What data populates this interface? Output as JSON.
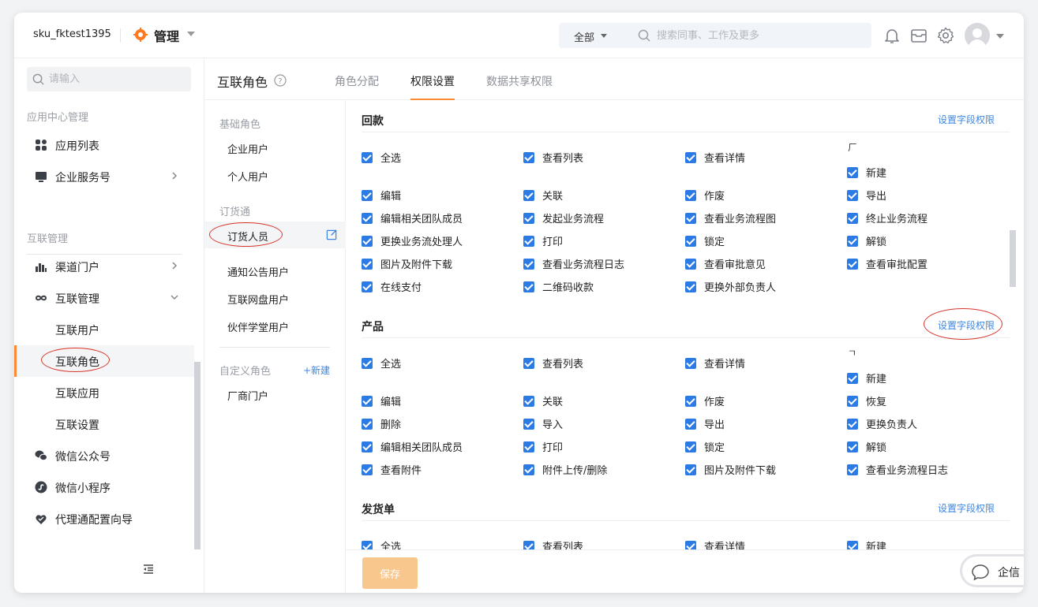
{
  "topbar": {
    "account": "sku_fktest1395",
    "brand": "管理",
    "scope": "全部",
    "search_placeholder": "搜索同事、工作及更多",
    "icons": [
      "bell-icon",
      "inbox-icon",
      "gear-icon",
      "avatar"
    ]
  },
  "sidebar": {
    "search_placeholder": "请输入",
    "section1": "应用中心管理",
    "app_list": "应用列表",
    "enterprise_service": "企业服务号",
    "section2": "互联管理",
    "channel_portal": "渠道门户",
    "interconnect_mgmt": "互联管理",
    "sub_users": "互联用户",
    "sub_roles": "互联角色",
    "sub_apps": "互联应用",
    "sub_settings": "互联设置",
    "wechat_official": "微信公众号",
    "wechat_mini": "微信小程序",
    "agent_wizard": "代理通配置向导"
  },
  "header": {
    "title": "互联角色",
    "tabs": [
      "角色分配",
      "权限设置",
      "数据共享权限"
    ],
    "active_tab": "权限设置"
  },
  "roles": {
    "group_basic": "基础角色",
    "enterprise_user": "企业用户",
    "personal_user": "个人用户",
    "group_dhtong": "订货通",
    "ordering_staff": "订货人员",
    "notice_user": "通知公告用户",
    "netdisk_user": "互联网盘用户",
    "academy_user": "伙伴学堂用户",
    "group_custom": "自定义角色",
    "new_role": "+新建",
    "vendor_portal": "厂商门户"
  },
  "permissions": {
    "field_perm_link": "设置字段权限",
    "sections": [
      {
        "title": "回款",
        "glyph": "ㄏ",
        "rows": [
          [
            "全选",
            "查看列表",
            "查看详情"
          ],
          [
            "新建"
          ],
          [
            "编辑",
            "关联",
            "作废",
            "导出"
          ],
          [
            "编辑相关团队成员",
            "发起业务流程",
            "查看业务流程图",
            "终止业务流程"
          ],
          [
            "更换业务流处理人",
            "打印",
            "锁定",
            "解锁"
          ],
          [
            "图片及附件下载",
            "查看业务流程日志",
            "查看审批意见",
            "查看审批配置"
          ],
          [
            "在线支付",
            "二维码收款",
            "更换外部负责人"
          ]
        ]
      },
      {
        "title": "产品",
        "glyph": "ㄱ",
        "rows": [
          [
            "全选",
            "查看列表",
            "查看详情"
          ],
          [
            "新建"
          ],
          [
            "编辑",
            "关联",
            "作废",
            "恢复"
          ],
          [
            "删除",
            "导入",
            "导出",
            "更换负责人"
          ],
          [
            "编辑相关团队成员",
            "打印",
            "锁定",
            "解锁"
          ],
          [
            "查看附件",
            "附件上传/删除",
            "图片及附件下载",
            "查看业务流程日志"
          ]
        ]
      },
      {
        "title": "发货单",
        "rows": [
          [
            "全选",
            "查看列表",
            "查看详情",
            "新建"
          ]
        ]
      }
    ]
  },
  "footer": {
    "save": "保存"
  },
  "chat": {
    "label": "企信"
  },
  "colors": {
    "accent": "#ff8a34",
    "link": "#3c86e0",
    "checkbox": "#2c7be5",
    "save_disabled": "#f8c78e",
    "annotation": "#d9342b"
  }
}
